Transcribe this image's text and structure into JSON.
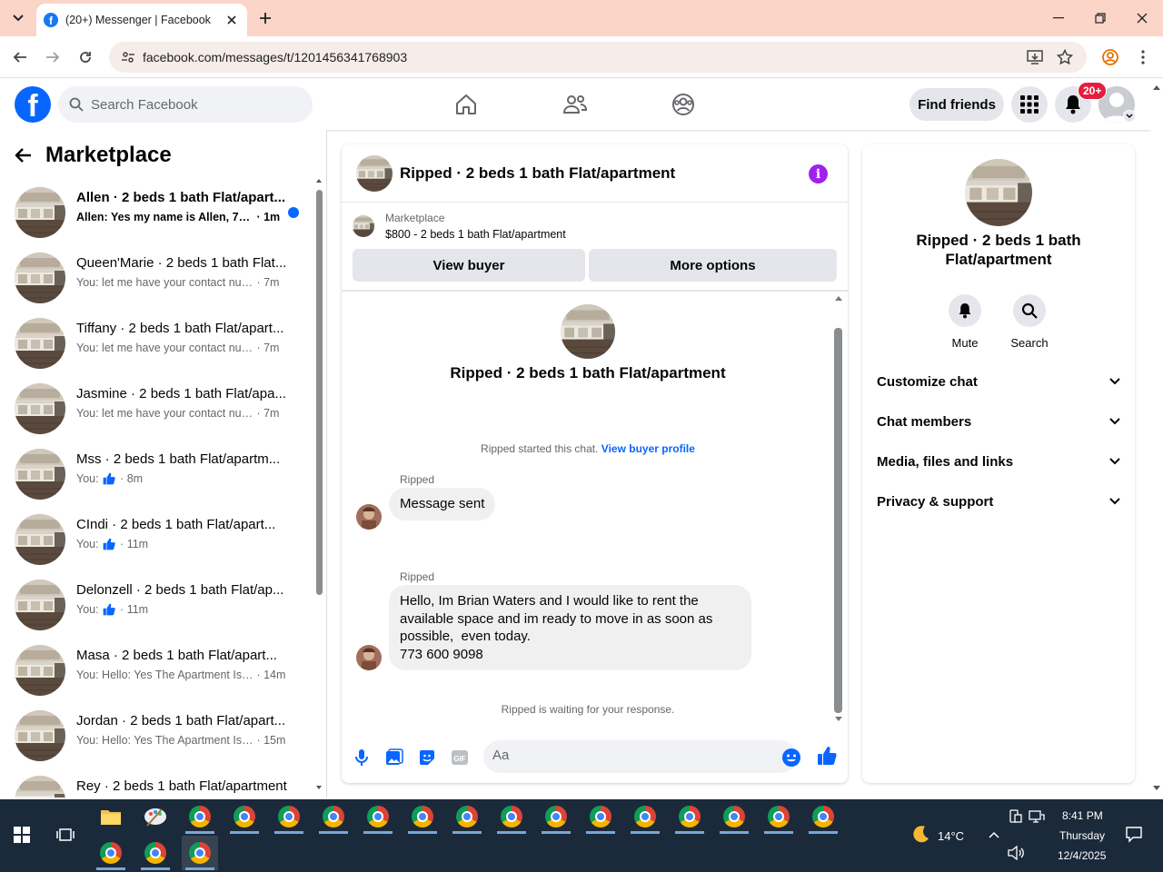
{
  "browser": {
    "tab_title": "(20+) Messenger | Facebook",
    "url": "facebook.com/messages/t/1201456341768903"
  },
  "fb": {
    "search_placeholder": "Search Facebook",
    "find_friends": "Find friends",
    "notif_badge": "20+"
  },
  "sidebar": {
    "title": "Marketplace",
    "conversations": [
      {
        "name": "Allen · 2 beds 1 bath Flat/apart...",
        "snippet": "Allen: Yes my name is Allen, 70...",
        "time": "1m",
        "unread": true,
        "like": false
      },
      {
        "name": "Queen'Marie · 2 beds 1 bath Flat...",
        "snippet": "You: let me have your contact num...",
        "time": "7m",
        "unread": false,
        "like": false
      },
      {
        "name": "Tiffany · 2 beds 1 bath Flat/apart...",
        "snippet": "You: let me have your contact num...",
        "time": "7m",
        "unread": false,
        "like": false
      },
      {
        "name": "Jasmine · 2 beds 1 bath Flat/apa...",
        "snippet": "You: let me have your contact num...",
        "time": "7m",
        "unread": false,
        "like": false
      },
      {
        "name": "Mss · 2 beds 1 bath Flat/apartm...",
        "snippet": "You:",
        "time": "8m",
        "unread": false,
        "like": true
      },
      {
        "name": "CIndi · 2 beds 1 bath Flat/apart...",
        "snippet": "You:",
        "time": "11m",
        "unread": false,
        "like": true
      },
      {
        "name": "Delonzell · 2 beds 1 bath Flat/ap...",
        "snippet": "You:",
        "time": "11m",
        "unread": false,
        "like": true
      },
      {
        "name": "Masa · 2 beds 1 bath Flat/apart...",
        "snippet": "You: Hello: Yes The Apartment Is ...",
        "time": "14m",
        "unread": false,
        "like": false
      },
      {
        "name": "Jordan · 2 beds 1 bath Flat/apart...",
        "snippet": "You: Hello: Yes The Apartment Is ...",
        "time": "15m",
        "unread": false,
        "like": false
      },
      {
        "name": "Rey · 2 beds 1 bath Flat/apartment",
        "snippet": "",
        "time": "",
        "unread": false,
        "like": false
      }
    ]
  },
  "chat": {
    "title": "Ripped · 2 beds 1 bath Flat/apartment",
    "listing_source": "Marketplace",
    "listing_price": "$800 - 2 beds 1 bath Flat/apartment",
    "view_buyer": "View buyer",
    "more_options": "More options",
    "thread_title": "Ripped · 2 beds 1 bath Flat/apartment",
    "started_text": "Ripped started this chat.",
    "view_profile": "View buyer profile",
    "messages": [
      {
        "sender": "Ripped",
        "text": "Message sent"
      },
      {
        "sender": "Ripped",
        "text_lines": [
          "Hello, Im Brian Waters and I would like to rent the",
          "available space and im ready to move in as soon as",
          "possible,  even today.",
          "773 600 9098"
        ]
      }
    ],
    "waiting": "Ripped is waiting for your response.",
    "composer_placeholder": "Aa"
  },
  "details": {
    "title": "Ripped · 2 beds 1 bath Flat/apartment",
    "mute": "Mute",
    "search": "Search",
    "sections": [
      "Customize chat",
      "Chat members",
      "Media, files and links",
      "Privacy & support"
    ]
  },
  "taskbar": {
    "weather": "14°C",
    "time": "8:41 PM",
    "day": "Thursday",
    "date": "12/4/2025"
  },
  "colors": {
    "fb_blue": "#0866ff",
    "info_purple": "#a020f0",
    "tab_bar": "#fbd5c8",
    "taskbar": "#1b2a3a"
  }
}
